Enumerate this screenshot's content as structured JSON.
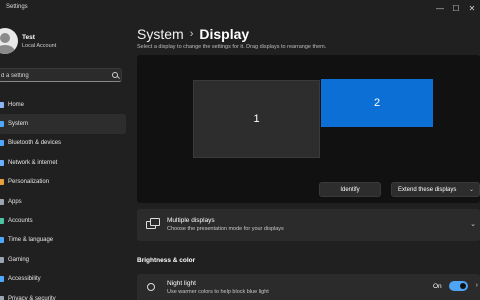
{
  "window": {
    "title": "Settings",
    "minimize_glyph": "—",
    "maximize_glyph": "☐",
    "close_glyph": "✕"
  },
  "profile": {
    "name": "Test",
    "account": "Local Account"
  },
  "search": {
    "placeholder": "d a setting"
  },
  "sidebar": {
    "items": [
      {
        "label": "Home",
        "icon": "home-icon",
        "color": "#8ab4f8",
        "active": false
      },
      {
        "label": "System",
        "icon": "system-icon",
        "color": "#4fa8ff",
        "active": true
      },
      {
        "label": "Bluetooth & devices",
        "icon": "bluetooth-icon",
        "color": "#4fa8ff",
        "active": false
      },
      {
        "label": "Network & internet",
        "icon": "network-icon",
        "color": "#6ab0ff",
        "active": false
      },
      {
        "label": "Personalization",
        "icon": "brush-icon",
        "color": "#e8a23c",
        "active": false
      },
      {
        "label": "Apps",
        "icon": "apps-icon",
        "color": "#9aa5b1",
        "active": false
      },
      {
        "label": "Accounts",
        "icon": "accounts-icon",
        "color": "#4fc3a1",
        "active": false
      },
      {
        "label": "Time & language",
        "icon": "globe-clock-icon",
        "color": "#4fa8ff",
        "active": false
      },
      {
        "label": "Gaming",
        "icon": "gaming-icon",
        "color": "#9aa5b1",
        "active": false
      },
      {
        "label": "Accessibility",
        "icon": "accessibility-icon",
        "color": "#4fa8ff",
        "active": false
      },
      {
        "label": "Privacy & security",
        "icon": "shield-icon",
        "color": "#9aa5b1",
        "active": false
      }
    ]
  },
  "breadcrumb": {
    "parent": "System",
    "separator": "›",
    "current": "Display"
  },
  "main": {
    "instruction": "Select a display to change the settings for it. Drag displays to rearrange them.",
    "monitors": [
      "1",
      "2"
    ],
    "identify_label": "Identify",
    "extend_label": "Extend these displays",
    "extend_chevron": "⌄",
    "multiple_displays": {
      "title": "Multiple displays",
      "subtitle": "Choose the presentation mode for your displays",
      "chevron": "⌄"
    },
    "brightness_heading": "Brightness & color",
    "night_light": {
      "title": "Night light",
      "subtitle": "Use warmer colors to help block blue light",
      "state_label": "On",
      "toggle_on": true,
      "chevron": "›"
    }
  },
  "colors": {
    "accent": "#0b6fd6",
    "toggle_on": "#4ea4f5",
    "background": "#202020",
    "card": "#2b2b2b"
  }
}
